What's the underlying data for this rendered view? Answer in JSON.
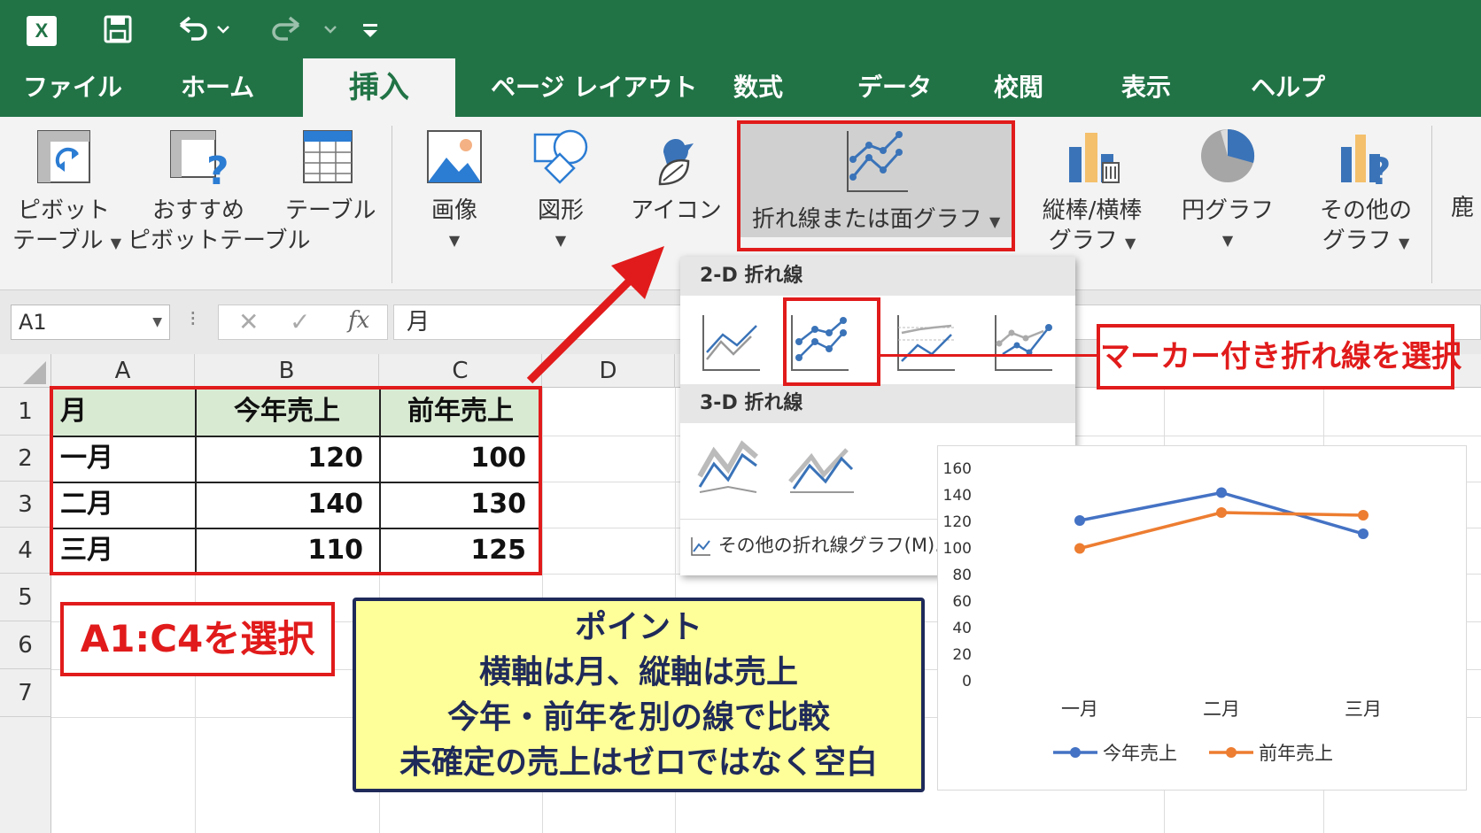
{
  "app": {
    "logo_letter": "X",
    "accent": "#217346"
  },
  "quick_access": {
    "icons": [
      "save-icon",
      "undo-icon",
      "redo-icon",
      "customize-icon"
    ]
  },
  "tabs": [
    {
      "label": "ファイル",
      "active": false
    },
    {
      "label": "ホーム",
      "active": false
    },
    {
      "label": "挿入",
      "active": true
    },
    {
      "label": "ページ レイアウト",
      "active": false
    },
    {
      "label": "数式",
      "active": false
    },
    {
      "label": "データ",
      "active": false
    },
    {
      "label": "校閲",
      "active": false
    },
    {
      "label": "表示",
      "active": false
    },
    {
      "label": "ヘルプ",
      "active": false
    }
  ],
  "ribbon": {
    "pivot": {
      "line1": "ピボット",
      "line2": "テーブル"
    },
    "rec_pivot": {
      "line1": "おすすめ",
      "line2": "ピボットテーブル"
    },
    "table": {
      "line1": "テーブル"
    },
    "image": {
      "line1": "画像"
    },
    "shapes": {
      "line1": "図形"
    },
    "icons": {
      "line1": "アイコン"
    },
    "line_chart": {
      "line1": "折れ線または面グラフ"
    },
    "bar_chart": {
      "line1": "縦棒/横棒",
      "line2": "グラフ"
    },
    "pie_chart": {
      "line1": "円グラフ"
    },
    "other_chart": {
      "line1": "その他の",
      "line2": "グラフ"
    },
    "cut_off": "鹿"
  },
  "formula_bar": {
    "name_box": "A1",
    "fx": "fx",
    "value": "月"
  },
  "grid": {
    "columns": [
      "A",
      "B",
      "C",
      "D"
    ],
    "rows": [
      "1",
      "2",
      "3",
      "4",
      "5",
      "6",
      "7"
    ],
    "headers": [
      "月",
      "今年売上",
      "前年売上"
    ],
    "data": [
      [
        "一月",
        "120",
        "100"
      ],
      [
        "二月",
        "140",
        "130"
      ],
      [
        "三月",
        "110",
        "125"
      ]
    ]
  },
  "dropdown": {
    "section_2d": "2-D 折れ線",
    "section_3d": "3-D 折れ線",
    "more": "その他の折れ線グラフ(M)..."
  },
  "callouts": {
    "select_range": "A1:C4を選択",
    "select_marker": "マーカー付き折れ線を選択",
    "point": [
      "ポイント",
      "横軸は月、縦軸は売上",
      "今年・前年を別の線で比較",
      "未確定の売上はゼロではなく空白"
    ]
  },
  "chart_data": {
    "type": "line",
    "categories": [
      "一月",
      "二月",
      "三月"
    ],
    "series": [
      {
        "name": "今年売上",
        "values": [
          120,
          141,
          110
        ],
        "color": "#4472c4"
      },
      {
        "name": "前年売上",
        "values": [
          99,
          126,
          124
        ],
        "color": "#ed7d31"
      }
    ],
    "ylim": [
      0,
      160
    ],
    "yticks": [
      "0",
      "20",
      "40",
      "60",
      "80",
      "100",
      "120",
      "140",
      "160"
    ],
    "legend": "bottom",
    "markers": true,
    "grid": false
  }
}
